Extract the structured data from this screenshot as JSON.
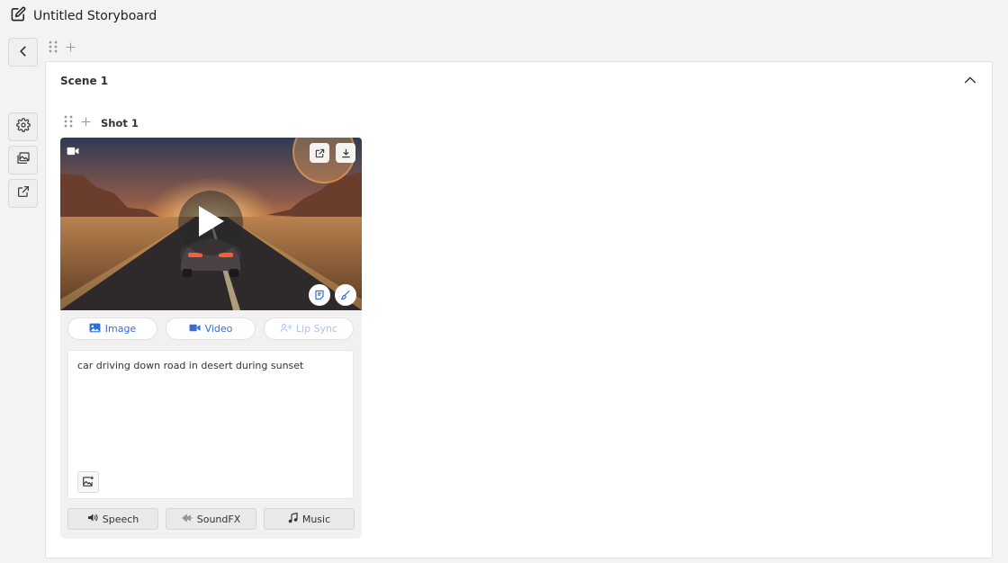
{
  "header": {
    "title": "Untitled Storyboard",
    "icon": "edit-icon"
  },
  "sidebar": {
    "items": [
      {
        "name": "back",
        "icon": "chevron-left-icon"
      },
      {
        "name": "settings",
        "icon": "gear-icon"
      },
      {
        "name": "gallery",
        "icon": "gallery-icon"
      },
      {
        "name": "share",
        "icon": "share-icon"
      }
    ]
  },
  "scene": {
    "title": "Scene 1",
    "shot": {
      "title": "Shot 1",
      "thumbnail": {
        "type": "video",
        "description_icon": "video-camera-icon"
      },
      "tabs": [
        {
          "label": "Image",
          "icon": "image-icon",
          "enabled": true
        },
        {
          "label": "Video",
          "icon": "video-camera-icon",
          "enabled": true
        },
        {
          "label": "Lip Sync",
          "icon": "lip-sync-icon",
          "enabled": false
        }
      ],
      "prompt": "car driving down road in desert during sunset",
      "audio": [
        {
          "label": "Speech",
          "icon": "speaker-icon"
        },
        {
          "label": "SoundFX",
          "icon": "waveform-icon"
        },
        {
          "label": "Music",
          "icon": "music-note-icon"
        }
      ]
    }
  },
  "colors": {
    "accent": "#2f6fd6",
    "highlight": "#ffaf5a"
  }
}
